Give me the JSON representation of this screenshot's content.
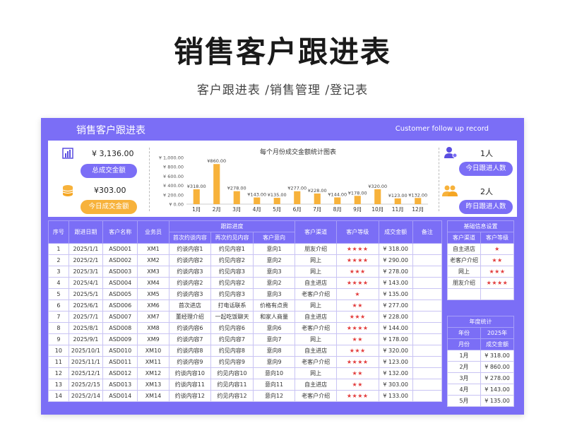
{
  "page": {
    "title": "销售客户跟进表",
    "subtitle": "客户跟进表 /销售管理 /登记表"
  },
  "sheet": {
    "title": "销售客户跟进表",
    "title_en": "Customer follow up record",
    "colors": {
      "primary": "#7b6ef6",
      "accent": "#f7b23b",
      "star": "#e23b3b"
    }
  },
  "kpis": {
    "total_amount": {
      "value": "¥ 3,136.00",
      "label": "总成交金额",
      "icon": "bar-chart-icon"
    },
    "today_amount": {
      "value": "¥303.00",
      "label": "今日成交金额",
      "icon": "coins-icon"
    },
    "today_followups": {
      "value": "1人",
      "label": "今日跟进人数",
      "icon": "person-icon"
    },
    "yesterday_followups": {
      "value": "2人",
      "label": "昨日跟进人数",
      "icon": "group-icon"
    }
  },
  "chart_data": {
    "type": "bar",
    "title": "每个月份成交金额统计图表",
    "categories": [
      "1月",
      "2月",
      "3月",
      "4月",
      "5月",
      "6月",
      "7月",
      "8月",
      "9月",
      "10月",
      "11月",
      "12月"
    ],
    "values": [
      318,
      860,
      278,
      143,
      135,
      277,
      228,
      144,
      178,
      320,
      123,
      132
    ],
    "data_labels": [
      "¥318.00",
      "¥860.00",
      "¥278.00",
      "¥143.00",
      "¥135.00",
      "¥277.00",
      "¥228.00",
      "¥144.00",
      "¥178.00",
      "¥320.00",
      "¥123.00",
      "¥132.00"
    ],
    "y_ticks": [
      "¥ 0.00",
      "¥ 200.00",
      "¥ 400.00",
      "¥ 600.00",
      "¥ 800.00",
      "¥ 1,000.00"
    ],
    "ylim": [
      0,
      1000
    ],
    "grid": false,
    "legend": "none",
    "color": "#f7b23b"
  },
  "main_table": {
    "headers": {
      "no": "序号",
      "date": "跟进日期",
      "customer": "客户名称",
      "salesman": "业务员",
      "progress": "跟踪进度",
      "first": "首次约谈内容",
      "second": "再次约见内容",
      "intent": "客户意向",
      "channel": "客户渠道",
      "level": "客户等级",
      "amount": "成交金额",
      "note": "备注"
    },
    "rows": [
      {
        "no": "1",
        "date": "2025/1/1",
        "customer": "ASD001",
        "salesman": "XM1",
        "first": "约谈内容1",
        "second": "约见内容1",
        "intent": "意向1",
        "channel": "朋友介绍",
        "level": "★★★★",
        "amount": "¥ 318.00",
        "note": ""
      },
      {
        "no": "2",
        "date": "2025/2/1",
        "customer": "ASD002",
        "salesman": "XM2",
        "first": "约谈内容2",
        "second": "约见内容2",
        "intent": "意向2",
        "channel": "网上",
        "level": "★★★★",
        "amount": "¥ 290.00",
        "note": ""
      },
      {
        "no": "3",
        "date": "2025/3/1",
        "customer": "ASD003",
        "salesman": "XM3",
        "first": "约谈内容3",
        "second": "约见内容3",
        "intent": "意向3",
        "channel": "网上",
        "level": "★★★",
        "amount": "¥ 278.00",
        "note": ""
      },
      {
        "no": "4",
        "date": "2025/4/1",
        "customer": "ASD004",
        "salesman": "XM4",
        "first": "约谈内容2",
        "second": "约见内容2",
        "intent": "意向2",
        "channel": "自主进店",
        "level": "★★★★",
        "amount": "¥ 143.00",
        "note": ""
      },
      {
        "no": "5",
        "date": "2025/5/1",
        "customer": "ASD005",
        "salesman": "XM5",
        "first": "约谈内容3",
        "second": "约见内容3",
        "intent": "意向3",
        "channel": "老客户介绍",
        "level": "★",
        "amount": "¥ 135.00",
        "note": ""
      },
      {
        "no": "6",
        "date": "2025/6/1",
        "customer": "ASD006",
        "salesman": "XM6",
        "first": "首次进店",
        "second": "打电话联系",
        "intent": "价格有点贵",
        "channel": "网上",
        "level": "★★",
        "amount": "¥ 277.00",
        "note": ""
      },
      {
        "no": "7",
        "date": "2025/7/1",
        "customer": "ASD007",
        "salesman": "XM7",
        "first": "董经理介绍",
        "second": "一起吃饭聊天",
        "intent": "和家人商量",
        "channel": "自主进店",
        "level": "★★★",
        "amount": "¥ 228.00",
        "note": ""
      },
      {
        "no": "8",
        "date": "2025/8/1",
        "customer": "ASD008",
        "salesman": "XM8",
        "first": "约谈内容6",
        "second": "约见内容6",
        "intent": "意向6",
        "channel": "老客户介绍",
        "level": "★★★★",
        "amount": "¥ 144.00",
        "note": ""
      },
      {
        "no": "9",
        "date": "2025/9/1",
        "customer": "ASD009",
        "salesman": "XM9",
        "first": "约谈内容7",
        "second": "约见内容7",
        "intent": "意向7",
        "channel": "网上",
        "level": "★★",
        "amount": "¥ 178.00",
        "note": ""
      },
      {
        "no": "10",
        "date": "2025/10/1",
        "customer": "ASD010",
        "salesman": "XM10",
        "first": "约谈内容8",
        "second": "约见内容8",
        "intent": "意向8",
        "channel": "自主进店",
        "level": "★★★",
        "amount": "¥ 320.00",
        "note": ""
      },
      {
        "no": "11",
        "date": "2025/11/1",
        "customer": "ASD011",
        "salesman": "XM11",
        "first": "约谈内容9",
        "second": "约见内容9",
        "intent": "意向9",
        "channel": "老客户介绍",
        "level": "★★★★",
        "amount": "¥ 123.00",
        "note": ""
      },
      {
        "no": "12",
        "date": "2025/12/1",
        "customer": "ASD012",
        "salesman": "XM12",
        "first": "约谈内容10",
        "second": "约见内容10",
        "intent": "意向10",
        "channel": "网上",
        "level": "★★",
        "amount": "¥ 132.00",
        "note": ""
      },
      {
        "no": "13",
        "date": "2025/2/15",
        "customer": "ASD013",
        "salesman": "XM13",
        "first": "约谈内容11",
        "second": "约见内容11",
        "intent": "意向11",
        "channel": "自主进店",
        "level": "★★",
        "amount": "¥ 303.00",
        "note": ""
      },
      {
        "no": "14",
        "date": "2025/2/14",
        "customer": "ASD014",
        "salesman": "XM14",
        "first": "约谈内容12",
        "second": "约见内容12",
        "intent": "意向12",
        "channel": "老客户介绍",
        "level": "★★★★",
        "amount": "¥ 133.00",
        "note": ""
      }
    ]
  },
  "basic_settings": {
    "title": "基础信息设置",
    "col_channel": "客户渠道",
    "col_level": "客户等级",
    "rows": [
      {
        "channel": "自主进店",
        "level": "★"
      },
      {
        "channel": "老客户介绍",
        "level": "★★"
      },
      {
        "channel": "网上",
        "level": "★★★"
      },
      {
        "channel": "朋友介绍",
        "level": "★★★★"
      },
      {
        "channel": "",
        "level": ""
      }
    ]
  },
  "year_stats": {
    "title": "年度统计",
    "year_label": "年份",
    "year_value": "2025年",
    "col_month": "月份",
    "col_amount": "成交金额",
    "rows": [
      {
        "month": "1月",
        "amount": "¥ 318.00"
      },
      {
        "month": "2月",
        "amount": "¥ 860.00"
      },
      {
        "month": "3月",
        "amount": "¥ 278.00"
      },
      {
        "month": "4月",
        "amount": "¥ 143.00"
      },
      {
        "month": "5月",
        "amount": "¥ 135.00"
      }
    ]
  }
}
